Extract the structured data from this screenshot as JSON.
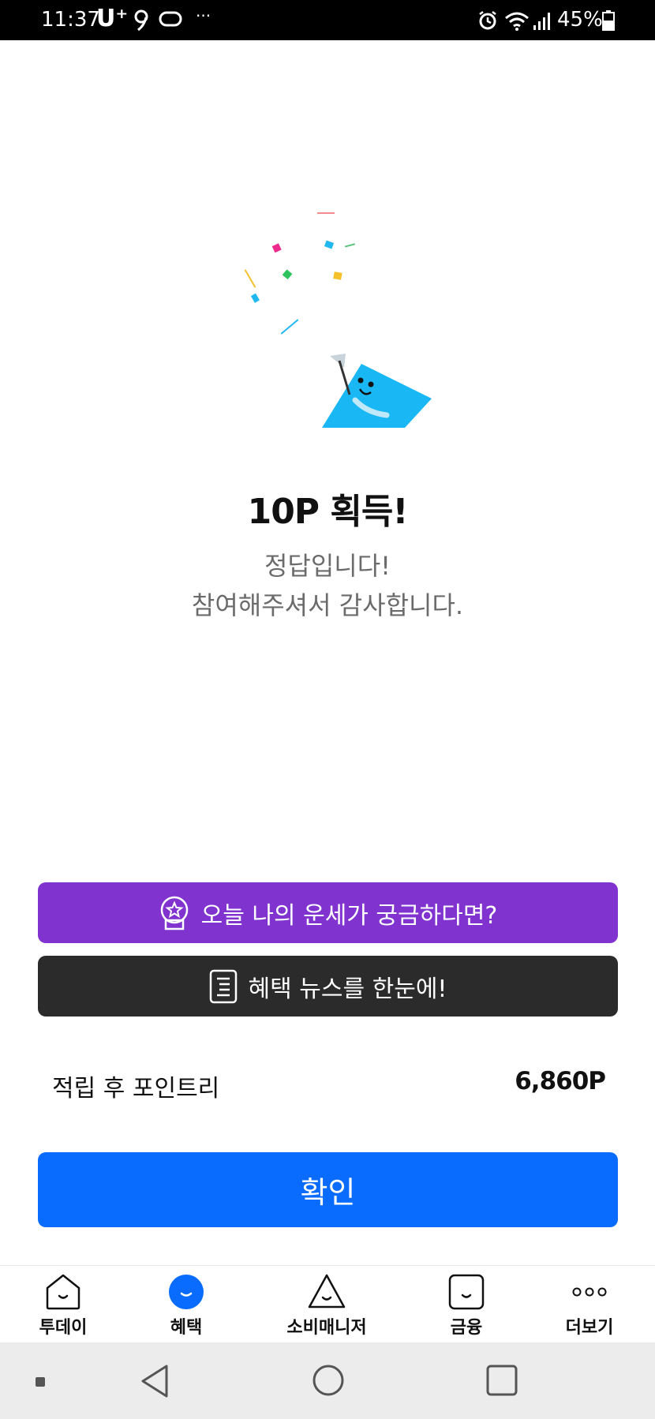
{
  "status_bar": {
    "time": "11:37",
    "carrier": "U⁺",
    "dots": "···",
    "battery": "45%"
  },
  "reward": {
    "title": "10P 획득!",
    "message_line1": "정답입니다!",
    "message_line2": "참여해주셔서 감사합니다."
  },
  "buttons": {
    "fortune_label": "오늘 나의 운세가 궁금하다면?",
    "news_label": "혜택 뉴스를 한눈에!",
    "confirm_label": "확인"
  },
  "points": {
    "label": "적립 후 포인트리",
    "value": "6,860P"
  },
  "nav": {
    "items": [
      {
        "label": "투데이",
        "icon": "today-house-icon"
      },
      {
        "label": "혜택",
        "icon": "benefit-face-icon",
        "active": true
      },
      {
        "label": "소비매니저",
        "icon": "spending-triangle-icon"
      },
      {
        "label": "금융",
        "icon": "finance-square-icon"
      },
      {
        "label": "더보기",
        "icon": "more-dots-icon"
      }
    ]
  },
  "colors": {
    "fortune_button": "#8133d0",
    "news_button": "#2b2b2b",
    "confirm_button": "#0a6cff",
    "mascot": "#19b8f5"
  }
}
